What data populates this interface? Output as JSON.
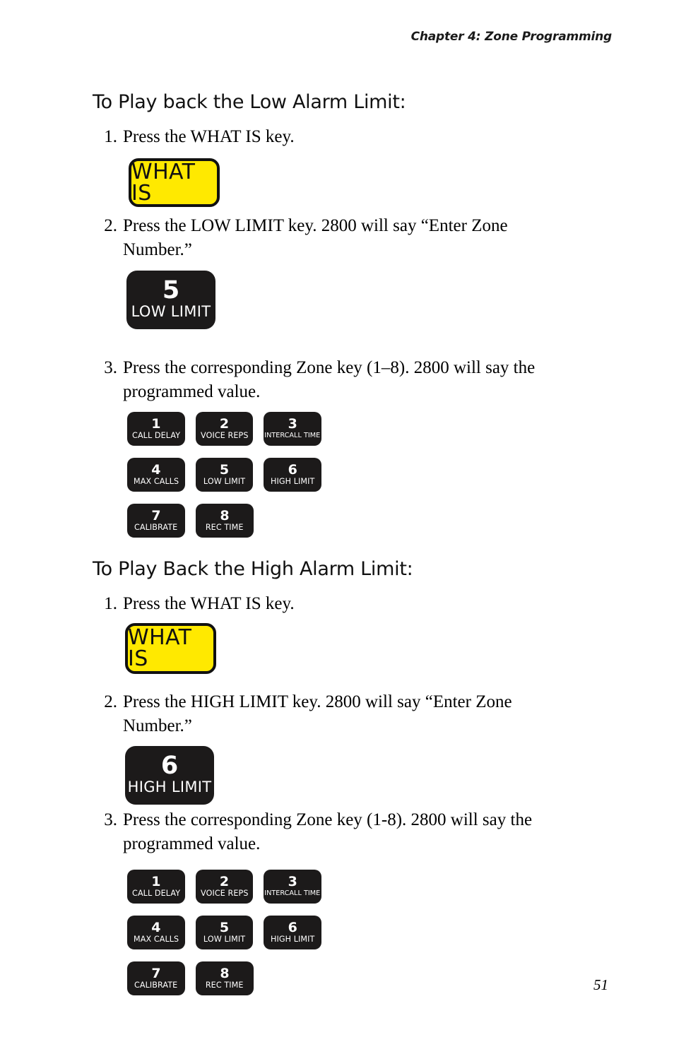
{
  "document": {
    "running_head": "Chapter 4: Zone Programming",
    "page_number": "51"
  },
  "sections": [
    {
      "heading": "To Play back the Low Alarm Limit:",
      "steps": [
        {
          "number": "1.",
          "text": "Press the WHAT IS key."
        },
        {
          "number": "2.",
          "text": "Press the LOW LIMIT key. 2800 will say “Enter Zone Number.”"
        },
        {
          "number": "3.",
          "text": "Press the corresponding Zone key (1–8). 2800 will say the programmed value."
        }
      ],
      "what_is_key": {
        "label": "WHAT IS"
      },
      "function_key": {
        "number": "5",
        "label": "LOW LIMIT"
      }
    },
    {
      "heading": "To Play Back the High Alarm Limit:",
      "steps": [
        {
          "number": "1.",
          "text": "Press the WHAT IS key."
        },
        {
          "number": "2.",
          "text": "Press the HIGH LIMIT key.  2800 will say “Enter Zone Number.”"
        },
        {
          "number": "3.",
          "text": "Press the corresponding Zone key (1-8). 2800 will say the programmed value."
        }
      ],
      "what_is_key": {
        "label": "WHAT IS"
      },
      "function_key": {
        "number": "6",
        "label": "HIGH LIMIT"
      }
    }
  ],
  "keypad": {
    "keys": [
      {
        "number": "1",
        "label": "CALL DELAY"
      },
      {
        "number": "2",
        "label": "VOICE REPS"
      },
      {
        "number": "3",
        "label": "INTERCALL TIME"
      },
      {
        "number": "4",
        "label": "MAX CALLS"
      },
      {
        "number": "5",
        "label": "LOW LIMIT"
      },
      {
        "number": "6",
        "label": "HIGH LIMIT"
      },
      {
        "number": "7",
        "label": "CALIBRATE"
      },
      {
        "number": "8",
        "label": "REC TIME"
      }
    ]
  },
  "colors": {
    "key_yellow": "#FFE900",
    "key_black": "#1C1A1A",
    "text": "#000000"
  }
}
